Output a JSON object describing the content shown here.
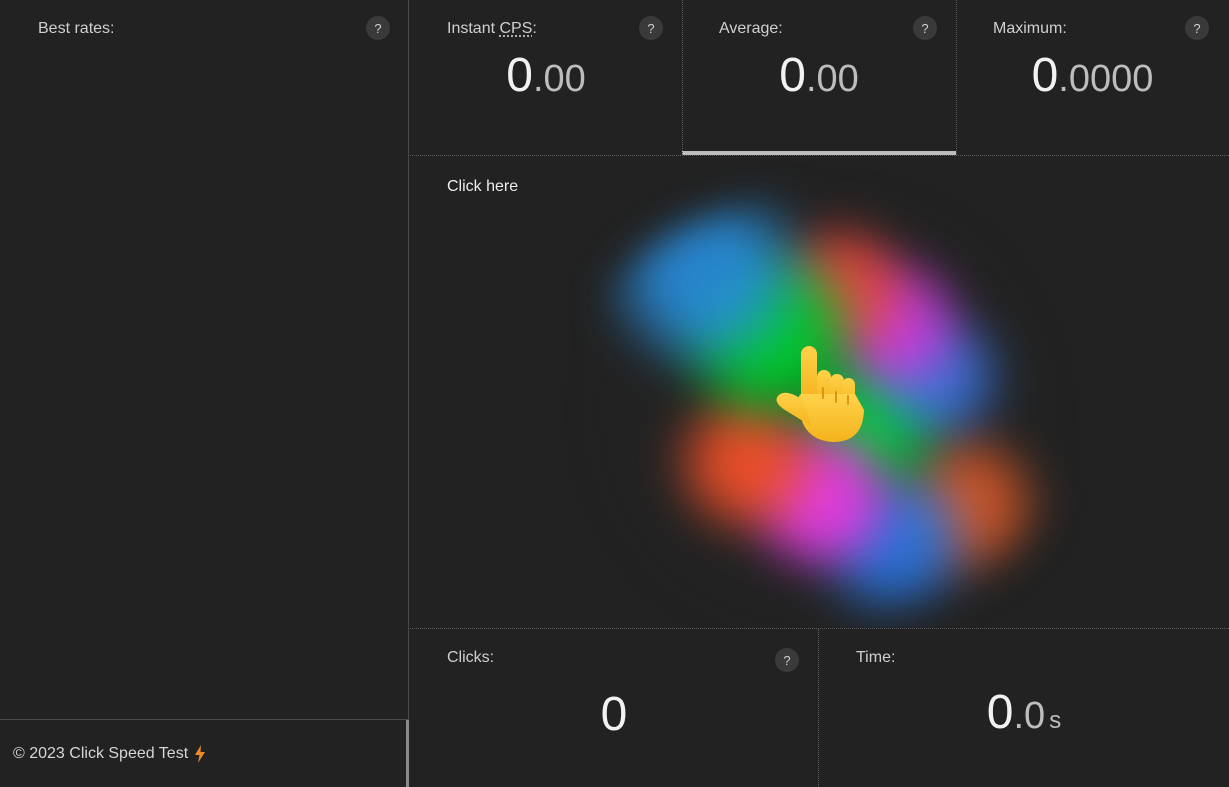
{
  "sidebar": {
    "title": "Best rates:",
    "help": "?"
  },
  "stats": {
    "instant": {
      "label_prefix": "Instant ",
      "label_abbr": "CPS",
      "label_suffix": ":",
      "int": "0",
      "frac": ".00",
      "help": "?"
    },
    "average": {
      "label": "Average:",
      "int": "0",
      "frac": ".00",
      "help": "?"
    },
    "maximum": {
      "label": "Maximum:",
      "int": "0",
      "frac": ".0000",
      "help": "?"
    }
  },
  "click_area": {
    "label": "Click here"
  },
  "counters": {
    "clicks": {
      "label": "Clicks:",
      "value": "0",
      "help": "?"
    },
    "time": {
      "label": "Time:",
      "int": "0",
      "frac": ".0",
      "unit": "s"
    }
  },
  "footer": {
    "text": "© 2023 Click Speed Test"
  },
  "colors": {
    "background": "#222222",
    "accent_bolt": "#f08a24",
    "active_tab": "#bdbdbd"
  },
  "icons": {
    "help": "question-mark-icon",
    "footer": "lightning-bolt-icon",
    "click": "pointing-hand-icon"
  }
}
